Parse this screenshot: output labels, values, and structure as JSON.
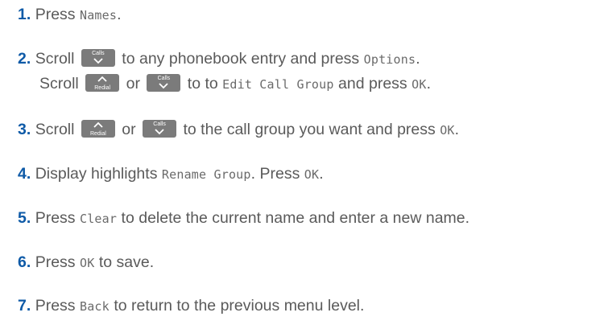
{
  "steps": [
    {
      "num": "1",
      "parts": [
        "Press ",
        "Names",
        "."
      ]
    },
    {
      "num": "2",
      "parts": [
        "Scroll ",
        " to any phonebook entry and press ",
        "Options",
        "."
      ],
      "line2": [
        "Scroll ",
        " or ",
        " to to ",
        "Edit Call Group",
        " and press ",
        "OK",
        "."
      ]
    },
    {
      "num": "3",
      "parts": [
        "Scroll ",
        " or ",
        " to the call group you want and press ",
        "OK",
        "."
      ]
    },
    {
      "num": "4",
      "parts": [
        "Display highlights ",
        "Rename Group",
        ". Press ",
        "OK",
        "."
      ]
    },
    {
      "num": "5",
      "parts": [
        "Press ",
        "Clear",
        " to delete the current name and enter a new name."
      ]
    },
    {
      "num": "6",
      "parts": [
        "Press ",
        "OK",
        " to save."
      ]
    },
    {
      "num": "7",
      "parts": [
        "Press ",
        "Back",
        " to return to the previous menu level."
      ]
    }
  ],
  "keys": {
    "calls": {
      "label": "Calls",
      "icon": "chevron-down-icon"
    },
    "redial": {
      "label": "Redial",
      "icon": "chevron-up-icon"
    }
  },
  "colors": {
    "step_number": "#0e5aa7",
    "text": "#5a5a5a",
    "key_bg": "#7b7b7b"
  }
}
